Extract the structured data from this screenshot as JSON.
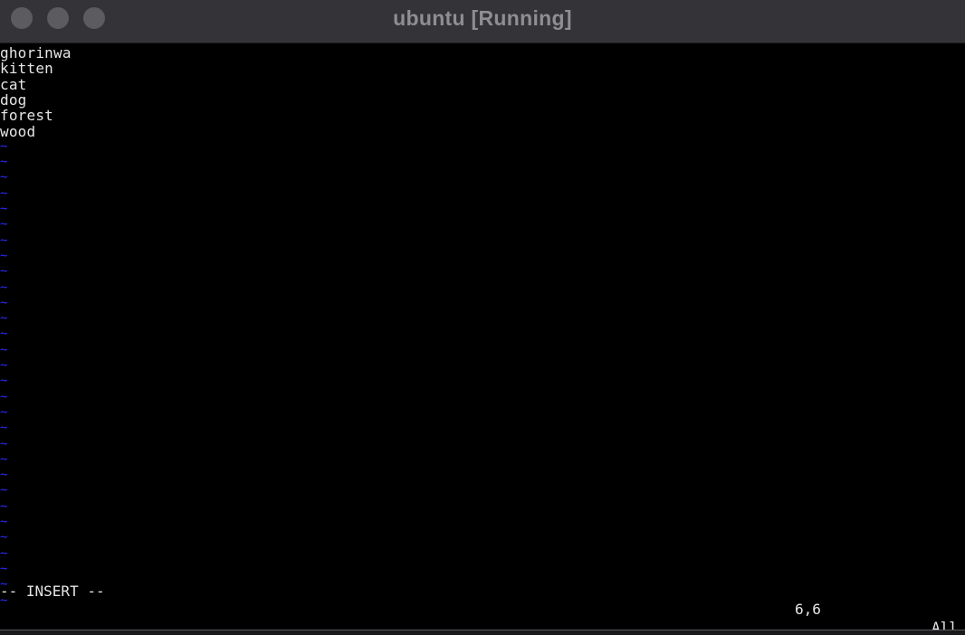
{
  "window": {
    "title": "ubuntu [Running]"
  },
  "buffer": {
    "lines": [
      "ghorinwa",
      "kitten",
      "cat",
      "dog",
      "forest",
      "wood"
    ],
    "empty_line_marker": "~",
    "empty_line_count": 30
  },
  "statusline": {
    "mode": "-- INSERT --",
    "cursor_position": "6,6",
    "scroll": "All"
  },
  "colors": {
    "background": "#000000",
    "text": "#e6e6e6",
    "tilde": "#2b2bff",
    "titlebar": "#333338",
    "title_text": "#8e8e93"
  }
}
